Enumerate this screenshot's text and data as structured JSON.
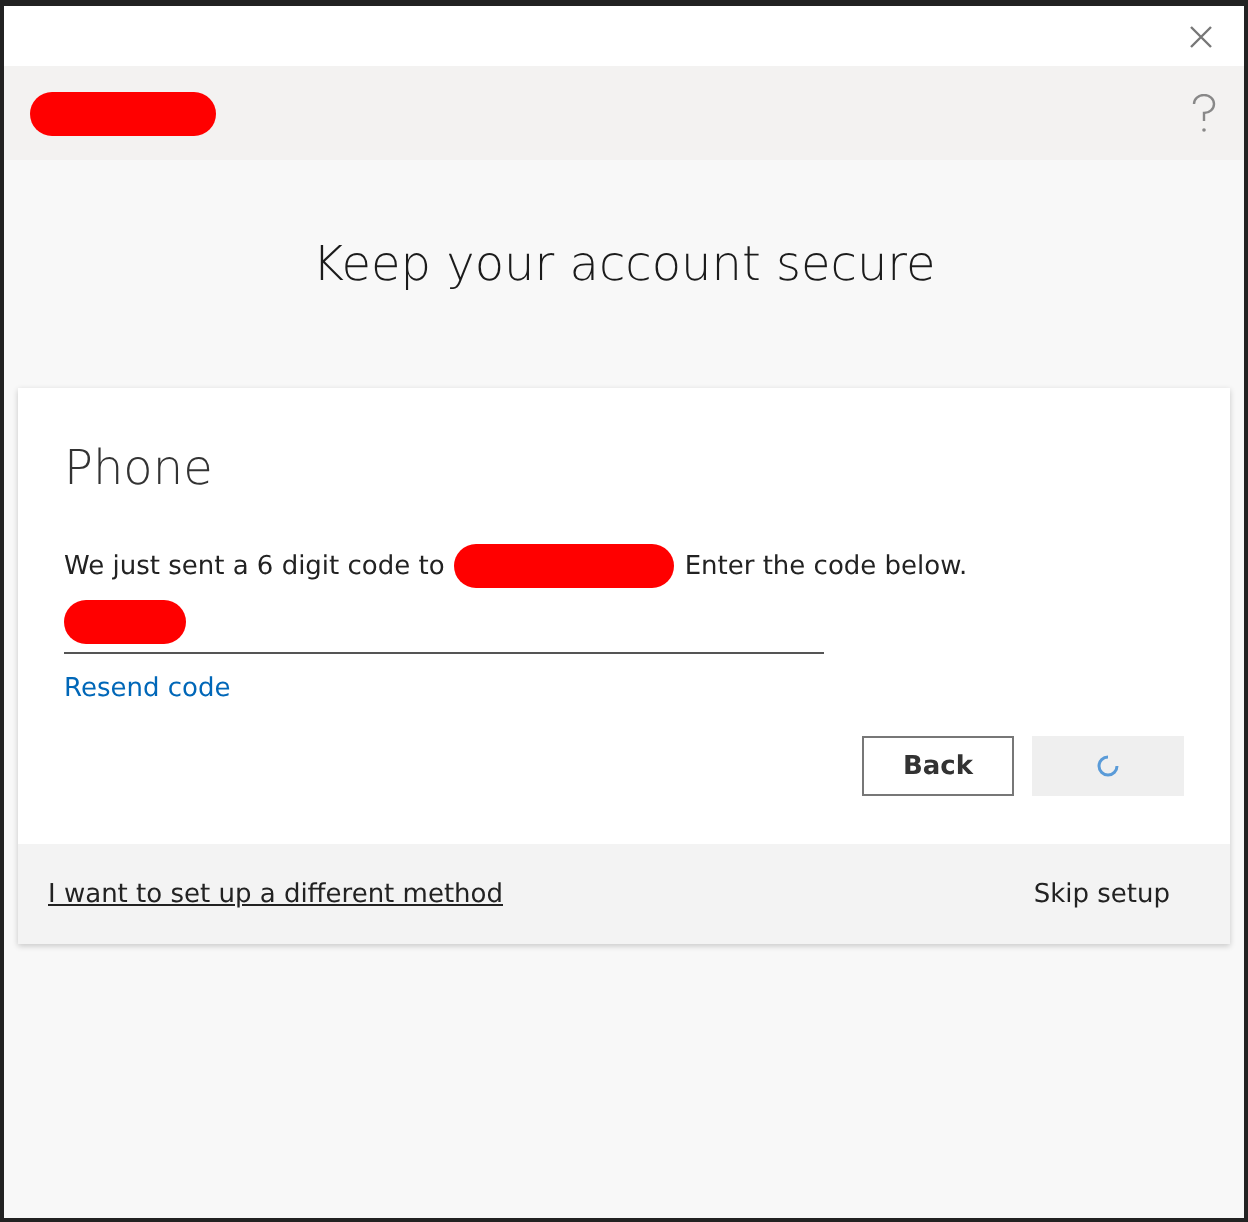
{
  "title": "Keep your account secure",
  "card": {
    "heading": "Phone",
    "message_before": "We just sent a 6 digit code to",
    "message_after": "Enter the code below.",
    "resend_link": "Resend code",
    "buttons": [
      {
        "label": "Back",
        "kind": "secondary"
      },
      {
        "kind": "loading"
      }
    ]
  },
  "footer": {
    "method_link": "I want to set up a different method",
    "skip_link": "Skip setup"
  }
}
